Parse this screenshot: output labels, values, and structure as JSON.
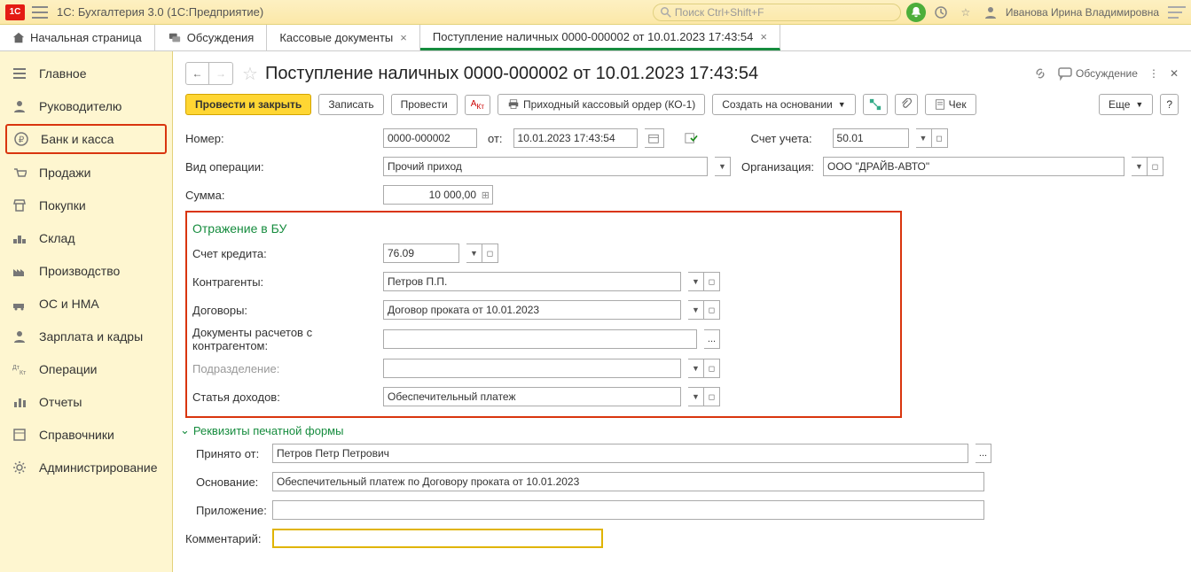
{
  "app": {
    "logo": "1C",
    "title": "1С: Бухгалтерия 3.0  (1С:Предприятие)"
  },
  "search": {
    "placeholder": "Поиск Ctrl+Shift+F"
  },
  "user": {
    "name": "Иванова Ирина Владимировна"
  },
  "tabs": [
    {
      "label": "Начальная страница",
      "home": true
    },
    {
      "label": "Обсуждения",
      "icon": true
    },
    {
      "label": "Кассовые документы",
      "closable": true
    },
    {
      "label": "Поступление наличных 0000-000002 от 10.01.2023 17:43:54",
      "closable": true,
      "active": true
    }
  ],
  "sidebar": [
    {
      "label": "Главное"
    },
    {
      "label": "Руководителю"
    },
    {
      "label": "Банк и касса",
      "active": true
    },
    {
      "label": "Продажи"
    },
    {
      "label": "Покупки"
    },
    {
      "label": "Склад"
    },
    {
      "label": "Производство"
    },
    {
      "label": "ОС и НМА"
    },
    {
      "label": "Зарплата и кадры"
    },
    {
      "label": "Операции"
    },
    {
      "label": "Отчеты"
    },
    {
      "label": "Справочники"
    },
    {
      "label": "Администрирование"
    }
  ],
  "page": {
    "title": "Поступление наличных 0000-000002 от 10.01.2023 17:43:54",
    "discuss": "Обсуждение"
  },
  "toolbar": {
    "post_close": "Провести и закрыть",
    "write": "Записать",
    "post": "Провести",
    "print": "Приходный кассовый ордер (КО-1)",
    "create_base": "Создать на основании",
    "check": "Чек",
    "more": "Еще",
    "help": "?"
  },
  "fields": {
    "number_l": "Номер:",
    "number_v": "0000-000002",
    "from_l": "от:",
    "date_v": "10.01.2023 17:43:54",
    "account_l": "Счет учета:",
    "account_v": "50.01",
    "optype_l": "Вид операции:",
    "optype_v": "Прочий приход",
    "org_l": "Организация:",
    "org_v": "ООО \"ДРАЙВ-АВТО\"",
    "sum_l": "Сумма:",
    "sum_v": "10 000,00",
    "bu_title": "Отражение в БУ",
    "credit_l": "Счет кредита:",
    "credit_v": "76.09",
    "counter_l": "Контрагенты:",
    "counter_v": "Петров П.П.",
    "contract_l": "Договоры:",
    "contract_v": "Договор проката от 10.01.2023",
    "docs_l": "Документы расчетов с контрагентом:",
    "docs_v": "",
    "division_l": "Подразделение:",
    "division_v": "",
    "income_l": "Статья доходов:",
    "income_v": "Обеспечительный платеж",
    "expand": "Реквизиты печатной формы",
    "received_l": "Принято от:",
    "received_v": "Петров Петр Петрович",
    "basis_l": "Основание:",
    "basis_v": "Обеспечительный платеж по Договору проката от 10.01.2023",
    "attach_l": "Приложение:",
    "attach_v": "",
    "comment_l": "Комментарий:",
    "comment_v": ""
  }
}
